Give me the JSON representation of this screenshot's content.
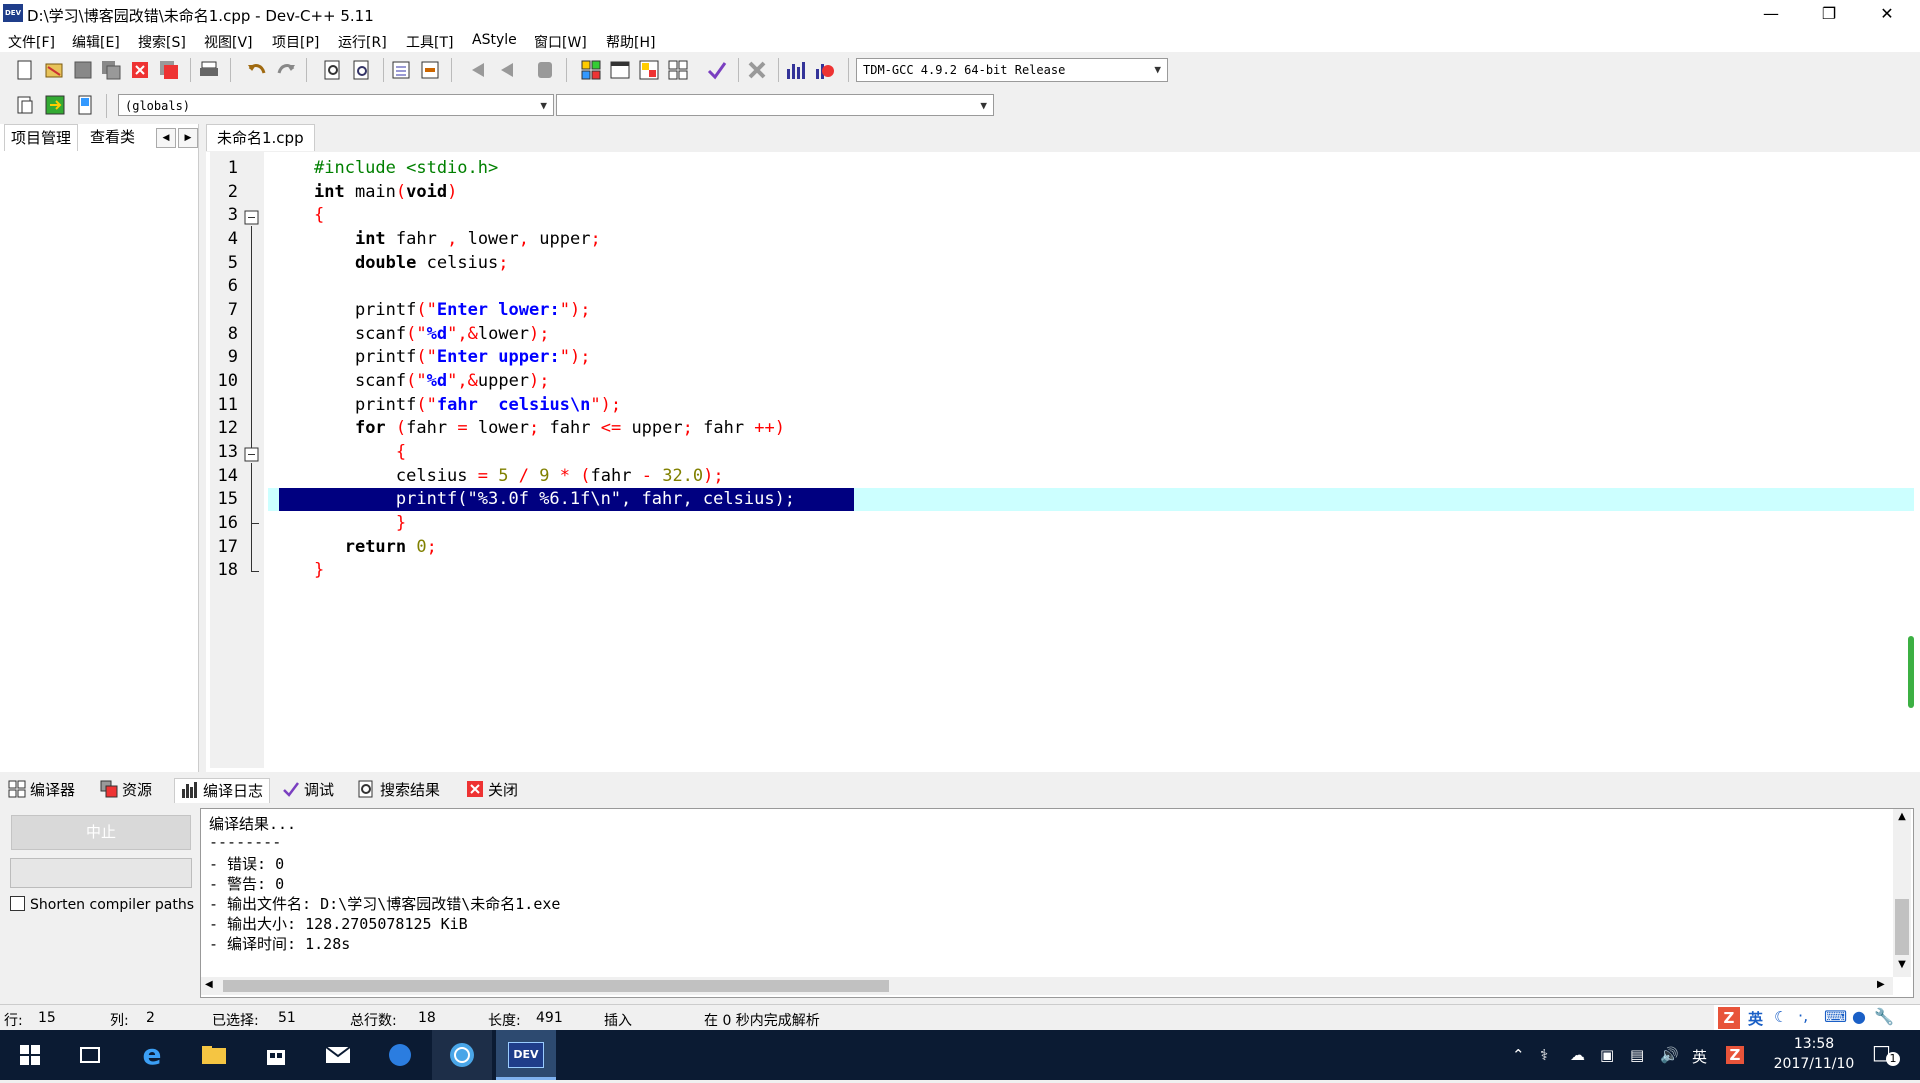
{
  "window": {
    "title": "D:\\学习\\博客园改错\\未命名1.cpp - Dev-C++ 5.11",
    "icon_label": "DEV",
    "minimize_icon": "minimize-icon",
    "maximize_icon": "restore-icon",
    "close_icon": "close-icon"
  },
  "menu": [
    "文件[F]",
    "编辑[E]",
    "搜索[S]",
    "视图[V]",
    "项目[P]",
    "运行[R]",
    "工具[T]",
    "AStyle",
    "窗口[W]",
    "帮助[H]"
  ],
  "toolbar": {
    "compiler_select": "TDM-GCC 4.9.2 64-bit Release",
    "scope_select": "(globals)",
    "function_select": ""
  },
  "left_panel": {
    "tabs": [
      "项目管理",
      "查看类"
    ],
    "nav_prev": "◀",
    "nav_next": "▶"
  },
  "editor": {
    "tab_label": "未命名1.cpp",
    "line_numbers": [
      "1",
      "2",
      "3",
      "4",
      "5",
      "6",
      "7",
      "8",
      "9",
      "10",
      "11",
      "12",
      "13",
      "14",
      "15",
      "16",
      "17",
      "18"
    ],
    "current_line": 15,
    "lines": [
      "#include <stdio.h>",
      "int main(void)",
      "{",
      "    int fahr , lower, upper;",
      "    double celsius;",
      "",
      "    printf(\"Enter lower:\");",
      "    scanf(\"%d\",&lower);",
      "    printf(\"Enter upper:\");",
      "    scanf(\"%d\",&upper);",
      "    printf(\"fahr  celsius\\n\");",
      "    for (fahr = lower; fahr <= upper; fahr ++)",
      "        {",
      "        celsius = 5 / 9 * (fahr - 32.0);",
      "        printf(\"%3.0f %6.1f\\n\", fahr, celsius);",
      "        }",
      "   return 0;",
      "}"
    ]
  },
  "bottom_tabs": [
    {
      "label": "编译器",
      "icon": "compiler-icon"
    },
    {
      "label": "资源",
      "icon": "resources-icon"
    },
    {
      "label": "编译日志",
      "icon": "compile-log-icon"
    },
    {
      "label": "调试",
      "icon": "debug-icon"
    },
    {
      "label": "搜索结果",
      "icon": "search-results-icon"
    },
    {
      "label": "关闭",
      "icon": "close-panel-icon"
    }
  ],
  "compile_panel": {
    "stop_button": "中止",
    "shorten_label": "Shorten compiler paths",
    "log": [
      "编译结果...",
      "--------",
      "- 错误: 0",
      "- 警告: 0",
      "- 输出文件名: D:\\学习\\博客园改错\\未命名1.exe",
      "- 输出大小: 128.2705078125 KiB",
      "- 编译时间: 1.28s"
    ]
  },
  "status": {
    "row_label": "行:",
    "row_value": "15",
    "col_label": "列:",
    "col_value": "2",
    "sel_label": "已选择:",
    "sel_value": "51",
    "total_label": "总行数:",
    "total_value": "18",
    "len_label": "长度:",
    "len_value": "491",
    "mode": "插入",
    "parse_msg": "在 0 秒内完成解析"
  },
  "ime": {
    "lang": "英"
  },
  "taskbar": {
    "time": "13:58",
    "date": "2017/11/10",
    "ime_lang": "英",
    "notification_count": "1",
    "devcpp_label": "DEV"
  }
}
